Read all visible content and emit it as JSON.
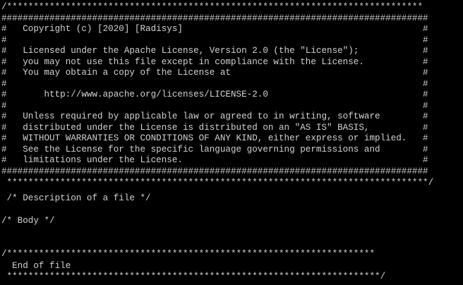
{
  "terminal": {
    "text_color": "#d3d3d3",
    "background_color": "#000000",
    "lines": [
      "/******************************************************************************",
      "################################################################################",
      "#   Copyright (c) [2020] [Radisys]                                             #",
      "#                                                                              #",
      "#   Licensed under the Apache License, Version 2.0 (the \"License\");            #",
      "#   you may not use this file except in compliance with the License.           #",
      "#   You may obtain a copy of the License at                                    #",
      "#                                                                              #",
      "#       http://www.apache.org/licenses/LICENSE-2.0                             #",
      "#                                                                              #",
      "#   Unless required by applicable law or agreed to in writing, software        #",
      "#   distributed under the License is distributed on an \"AS IS\" BASIS,          #",
      "#   WITHOUT WARRANTIES OR CONDITIONS OF ANY KIND, either express or implied.   #",
      "#   See the License for the specific language governing permissions and        #",
      "#   limitations under the License.                                             #",
      "################################################################################",
      " *******************************************************************************/",
      " /* Description of a file */",
      "",
      "/* Body */",
      "",
      "",
      "/*********************************************************************",
      "  End of file",
      " **********************************************************************/"
    ]
  }
}
